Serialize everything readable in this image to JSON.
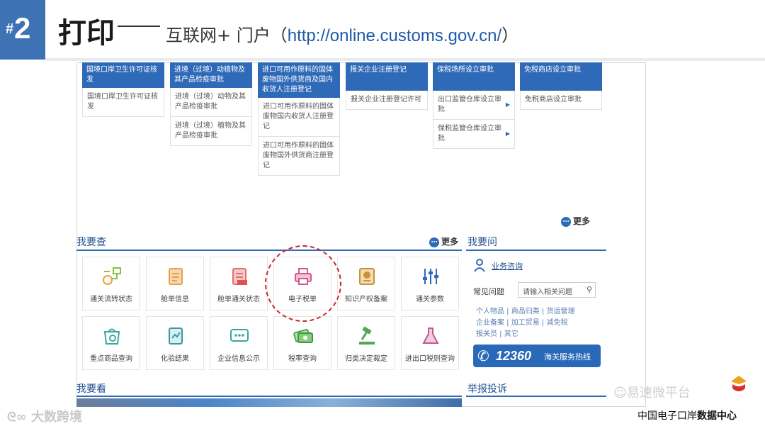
{
  "header": {
    "badge_hash": "#",
    "badge_number": "2",
    "title": "打印",
    "subtitle_prefix": "互联网+ 门户（",
    "url": "http://online.customs.gov.cn/",
    "subtitle_suffix": "）",
    "colors": {
      "badge": "#3d73b5",
      "accent": "#2f6ab8",
      "highlight": "#c92a2a"
    }
  },
  "service_cards": [
    {
      "head": "国境口岸卫生许可证核发",
      "rows": [
        "国境口岸卫生许可证核发"
      ]
    },
    {
      "head": "进境（过境）动植物及其产品检疫审批",
      "rows": [
        "进境（过境）动物及其产品检疫审批",
        "进境（过境）植物及其产品检疫审批"
      ]
    },
    {
      "head": "进口可用作原料的固体废物国外供货商及国内收货人注册登记",
      "rows": [
        "进口可用作原料的固体废物国内收货人注册登记",
        "进口可用作原料的固体废物国外供货商注册登记"
      ]
    },
    {
      "head": "报关企业注册登记",
      "rows": [
        "报关企业注册登记许可"
      ]
    },
    {
      "head": "保税场所设立审批",
      "rows": [
        "出口监管仓库设立审批",
        "保税监管仓库设立审批"
      ]
    },
    {
      "head": "免税商店设立审批",
      "rows": [
        "免税商店设立审批"
      ]
    }
  ],
  "more_label": "更多",
  "query_section": {
    "title": "我要查",
    "more": "更多",
    "tiles": [
      {
        "label": "通关流转状态",
        "icon": "flow-icon"
      },
      {
        "label": "舱单信息",
        "icon": "manifest-icon"
      },
      {
        "label": "舱单通关状态",
        "icon": "manifest-new-icon"
      },
      {
        "label": "电子税单",
        "icon": "printer-icon"
      },
      {
        "label": "知识产权备案",
        "icon": "ip-certificate-icon"
      },
      {
        "label": "通关参数",
        "icon": "sliders-icon"
      },
      {
        "label": "重点商品查询",
        "icon": "bag-search-icon"
      },
      {
        "label": "化验结果",
        "icon": "report-icon"
      },
      {
        "label": "企业信息公示",
        "icon": "chat-icon"
      },
      {
        "label": "税率查询",
        "icon": "money-icon"
      },
      {
        "label": "归类决定裁定",
        "icon": "gavel-icon"
      },
      {
        "label": "进出口税则查询",
        "icon": "flask-icon"
      }
    ]
  },
  "ask_section": {
    "title": "我要问",
    "consult": "业务咨询",
    "faq_label": "常见问题",
    "search_placeholder": "请输入相关问题",
    "links": [
      [
        "个人物品",
        "商品归类",
        "货运管理"
      ],
      [
        "企业备案",
        "加工贸易",
        "减免税"
      ],
      [
        "报关员",
        "其它"
      ]
    ],
    "hotline_number": "12360",
    "hotline_text": "海关服务热线"
  },
  "look_section": {
    "title": "我要看"
  },
  "report_section": {
    "title": "举报投诉"
  },
  "watermarks": {
    "left": "大数跨境",
    "right": "易速微平台",
    "brand_regular": "中国电子口岸",
    "brand_bold": "数据中心"
  }
}
